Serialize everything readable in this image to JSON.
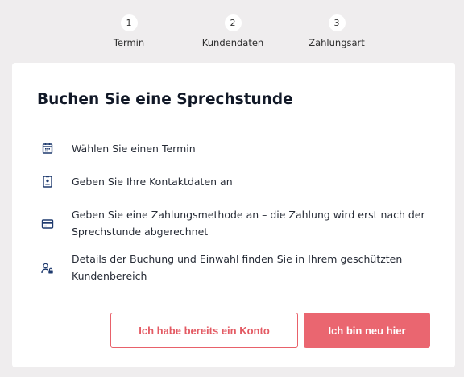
{
  "steps": [
    {
      "number": "1",
      "label": "Termin"
    },
    {
      "number": "2",
      "label": "Kundendaten"
    },
    {
      "number": "3",
      "label": "Zahlungsart"
    }
  ],
  "card": {
    "title": "Buchen Sie eine Sprechstunde",
    "items": [
      {
        "icon": "calendar-icon",
        "text": "Wählen Sie einen Termin"
      },
      {
        "icon": "contact-card-icon",
        "text": "Geben Sie Ihre Kontaktdaten an"
      },
      {
        "icon": "credit-card-icon",
        "text": "Geben Sie eine Zahlungsmethode an – die Zahlung wird erst nach der Sprechstunde abgerechnet"
      },
      {
        "icon": "user-lock-icon",
        "text": "Details der Buchung und Einwahl finden Sie in Ihrem geschützten Kundenbereich"
      }
    ]
  },
  "buttons": {
    "existing_account": "Ich habe bereits ein Konto",
    "new_here": "Ich bin neu hier"
  },
  "colors": {
    "accent": "#ea6670",
    "icon": "#1e3a6e",
    "background": "#efedee"
  }
}
